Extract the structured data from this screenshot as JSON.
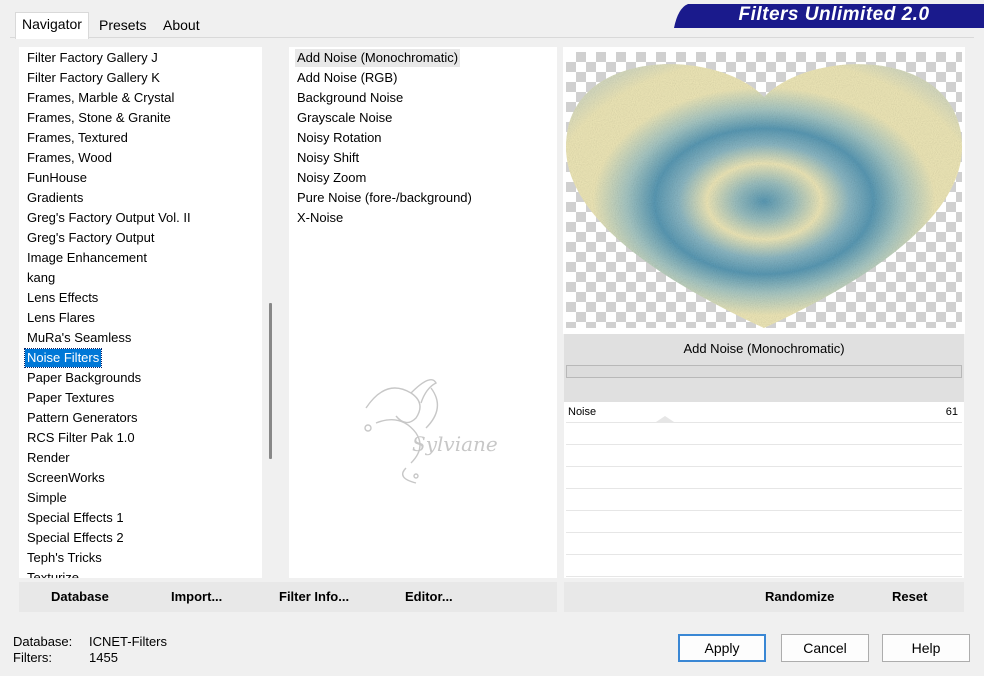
{
  "tabs": [
    {
      "label": "Navigator",
      "active": true
    },
    {
      "label": "Presets",
      "active": false
    },
    {
      "label": "About",
      "active": false
    }
  ],
  "banner": {
    "title": "Filters Unlimited 2.0",
    "color": "#1a1a8c"
  },
  "categories": {
    "items": [
      "Filter Factory Gallery J",
      "Filter Factory Gallery K",
      "Frames, Marble & Crystal",
      "Frames, Stone & Granite",
      "Frames, Textured",
      "Frames, Wood",
      "FunHouse",
      "Gradients",
      "Greg's Factory Output Vol. II",
      "Greg's Factory Output",
      "Image Enhancement",
      "kang",
      "Lens Effects",
      "Lens Flares",
      "MuRa's Seamless",
      "Noise Filters",
      "Paper Backgrounds",
      "Paper Textures",
      "Pattern Generators",
      "RCS Filter Pak 1.0",
      "Render",
      "ScreenWorks",
      "Simple",
      "Special Effects 1",
      "Special Effects 2",
      "Teph's Tricks",
      "Texturize"
    ],
    "selected": "Noise Filters"
  },
  "filters": {
    "items": [
      "Add Noise (Monochromatic)",
      "Add Noise (RGB)",
      "Background Noise",
      "Grayscale Noise",
      "Noisy Rotation",
      "Noisy Shift",
      "Noisy Zoom",
      "Pure Noise (fore-/background)",
      "X-Noise"
    ],
    "selected": "Add Noise (Monochromatic)"
  },
  "left_buttons": {
    "database": "Database",
    "import": "Import...",
    "filter_info": "Filter Info...",
    "editor": "Editor..."
  },
  "watermark": {
    "text": "Sylviane"
  },
  "preview": {
    "filter_name": "Add Noise (Monochromatic)"
  },
  "parameters": [
    {
      "label": "Noise",
      "value": "61"
    }
  ],
  "right_buttons": {
    "randomize": "Randomize",
    "reset": "Reset"
  },
  "status": {
    "database_label": "Database:",
    "database_value": "ICNET-Filters",
    "filters_label": "Filters:",
    "filters_value": "1455"
  },
  "dialog_buttons": {
    "apply": "Apply",
    "cancel": "Cancel",
    "help": "Help"
  },
  "colors": {
    "selection": "#0078d7",
    "noise_blue": "#5a9ab5",
    "noise_cream": "#efe8b8"
  }
}
